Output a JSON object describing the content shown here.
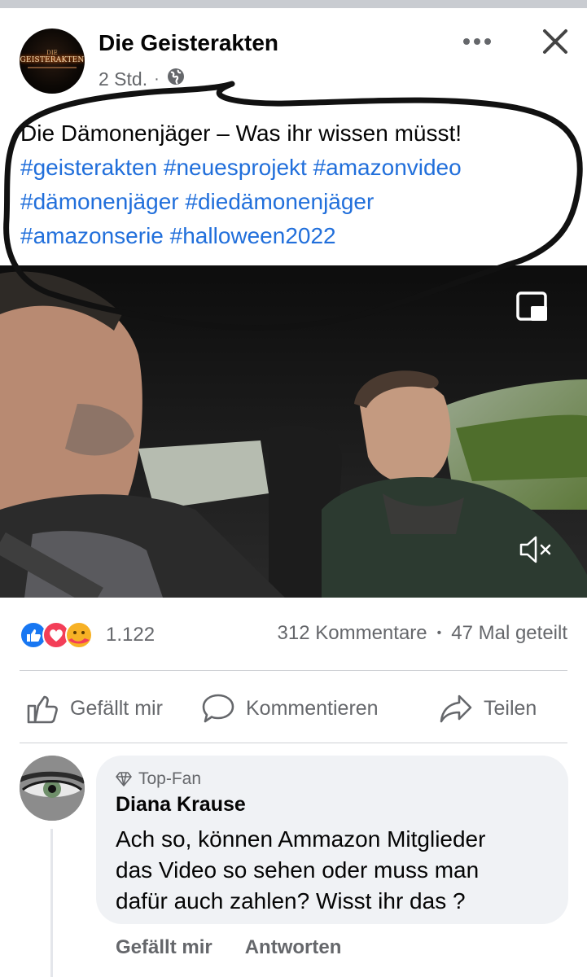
{
  "post": {
    "page_name": "Die Geisterakten",
    "avatar_logo_small": "DIE",
    "avatar_logo": "GEISTERAKTEN",
    "time": "2 Std.",
    "separator": "·",
    "privacy_icon": "globe-icon",
    "text_line": "Die Dämonenjäger – Was ihr wissen müsst!",
    "hashtags": [
      "#geisterakten",
      "#neuesprojekt",
      "#amazonvideo",
      "#dämonenjäger",
      "#diedämonenjäger",
      "#amazonserie",
      "#halloween2022"
    ]
  },
  "video": {
    "pip_icon": "picture-in-picture-icon",
    "mute_icon": "muted-speaker-icon"
  },
  "stats": {
    "reaction_icons": [
      "like-icon",
      "love-icon",
      "care-icon"
    ],
    "reaction_count": "1.122",
    "comments": "312 Kommentare",
    "dot": "•",
    "shares": "47 Mal geteilt"
  },
  "actions": {
    "like": "Gefällt mir",
    "comment": "Kommentieren",
    "share": "Teilen"
  },
  "comment": {
    "badge": "Top-Fan",
    "author": "Diana Krause",
    "lines": [
      "Ach so, können Ammazon Mitglieder",
      "das Video so sehen oder muss man",
      "dafür auch zahlen? Wisst ihr das ?"
    ],
    "like": "Gefällt mir",
    "reply": "Antworten"
  },
  "colors": {
    "hashtag": "#216fdb",
    "secondary_text": "#65676b",
    "bubble_bg": "#f0f2f5",
    "like_blue": "#1877f2",
    "love_red": "#f33e58"
  }
}
